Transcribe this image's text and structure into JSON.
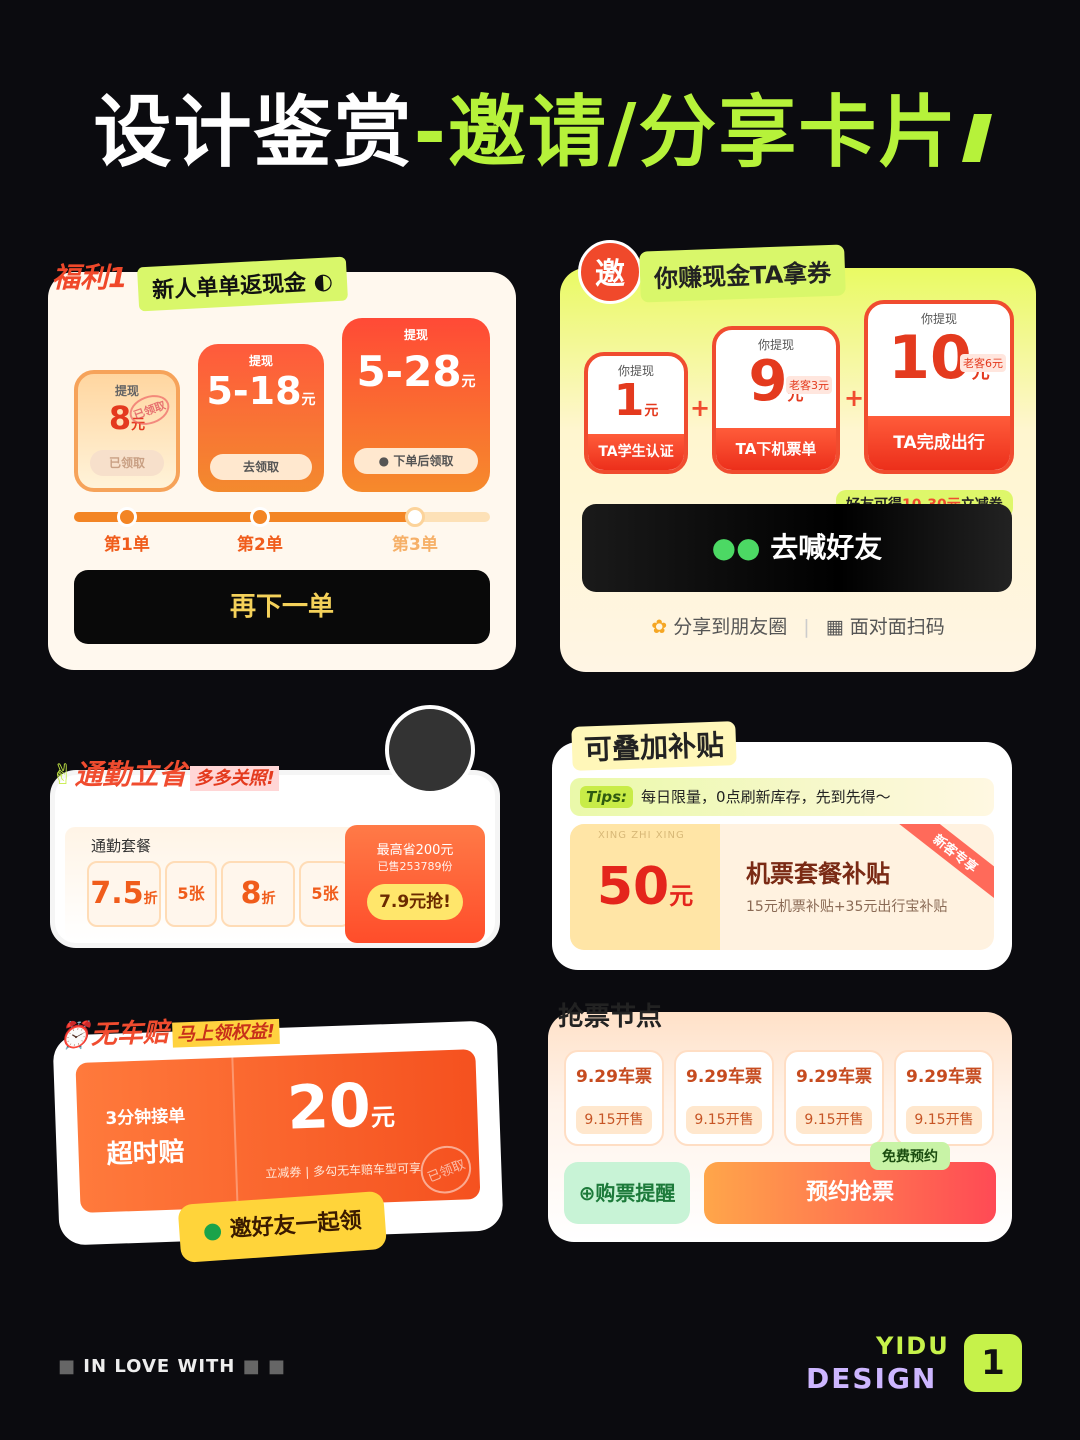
{
  "header": {
    "title_white": "设计鉴赏",
    "title_green": "-邀请/分享卡片"
  },
  "card1": {
    "tag_main": "福利1",
    "tag_text": "新人单单返现金",
    "coupons": [
      {
        "top": "提现",
        "amount": "8",
        "unit": "元",
        "button": "已领取",
        "stamp": "已领取"
      },
      {
        "top": "提现",
        "amount": "5-18",
        "unit": "元",
        "button": "去领取"
      },
      {
        "top": "提现",
        "amount": "5-28",
        "unit": "元",
        "button": "下单后领取"
      }
    ],
    "steps": [
      "第1单",
      "第2单",
      "第3单"
    ],
    "cta": "再下一单"
  },
  "card2": {
    "badge": "邀",
    "tag": "你赚现金TA拿券",
    "cards": [
      {
        "top": "你提现",
        "amount": "1",
        "unit": "元",
        "label": "TA学生认证"
      },
      {
        "top": "你提现",
        "amount": "9",
        "unit": "元",
        "extra": "老客3元",
        "label": "TA下机票单"
      },
      {
        "top": "你提现",
        "amount": "10",
        "unit": "元",
        "extra": "老客6元",
        "label": "TA完成出行"
      }
    ],
    "friend_pre": "好友可得",
    "friend_range": "10-30元",
    "friend_post": "立减券",
    "cta": "去喊好友",
    "share1": "分享到朋友圈",
    "share2": "面对面扫码"
  },
  "card3": {
    "tag": "通勤立省",
    "tag2": "多多关照!",
    "label": "通勤套餐",
    "chips": [
      {
        "v": "7.5",
        "u": "折"
      },
      {
        "v": "5",
        "u": "张"
      },
      {
        "v": "8",
        "u": "折"
      },
      {
        "v": "5",
        "u": "张"
      }
    ],
    "save": "最高省200元",
    "sold": "已售253789份",
    "buy": "7.9元抢!"
  },
  "card4": {
    "tag": "可叠加补贴",
    "tips_label": "Tips:",
    "tips": "每日限量，0点刷新库存，先到先得～",
    "amount": "50",
    "unit": "元",
    "ghost": "XING ZHI XING",
    "title": "机票套餐补贴",
    "desc": "15元机票补贴+35元出行宝补贴",
    "ribbon": "新客专享"
  },
  "card5": {
    "tag": "无车赔",
    "tag2": "马上领权益!",
    "left1": "3分钟接单",
    "left2": "超时赔",
    "amount": "20",
    "unit": "元",
    "desc1": "立减券",
    "desc2": "多勾无车赔车型可享",
    "stamp": "已领取",
    "cta": "邀好友一起领"
  },
  "card6": {
    "tag": "抢票节点",
    "tickets": [
      {
        "date": "9.29车票",
        "open": "9.15开售"
      },
      {
        "date": "9.29车票",
        "open": "9.15开售"
      },
      {
        "date": "9.29车票",
        "open": "9.15开售"
      },
      {
        "date": "9.29车票",
        "open": "9.15开售"
      }
    ],
    "remind": "购票提醒",
    "reserve": "预约抢票",
    "free": "免费预约"
  },
  "footer": {
    "left": "IN LOVE WITH",
    "brand1": "YIDU",
    "brand2": "DESIGN",
    "logo": "1"
  },
  "colors": {
    "bg": "#0b0b0f",
    "accent": "#b6f23a",
    "orange": "#f38524",
    "red": "#f04c2f"
  }
}
